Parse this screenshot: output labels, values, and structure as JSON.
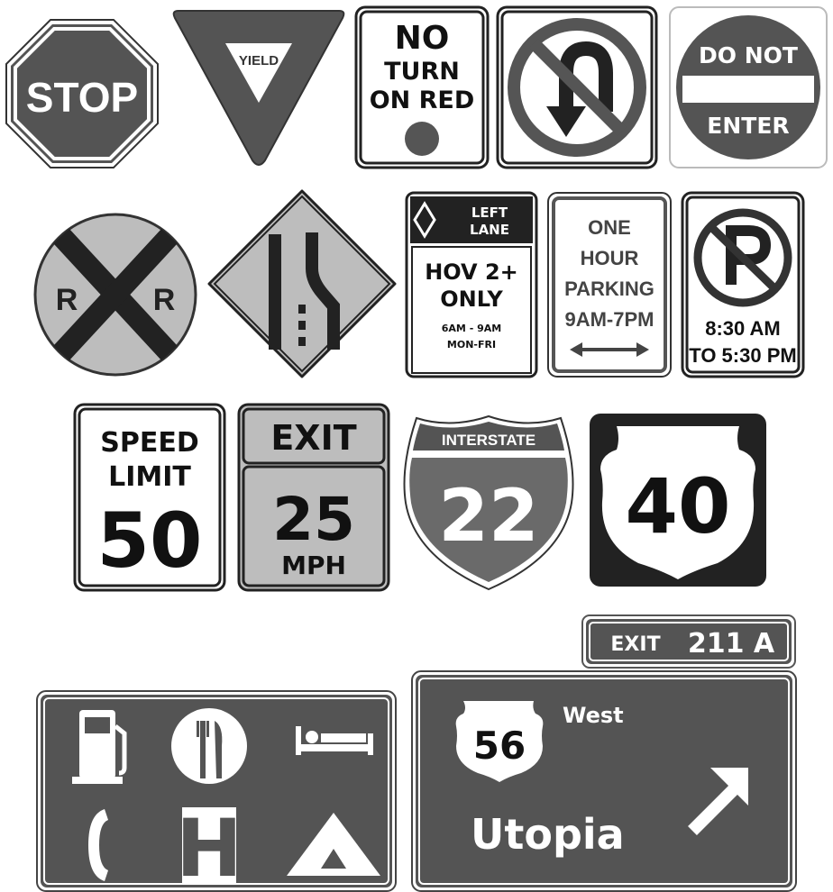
{
  "colors": {
    "dark": "#545454",
    "green_guide": "#5c5c5c",
    "yellow_warning": "#bdbdbd",
    "black": "#111111",
    "white": "#ffffff"
  },
  "stop": {
    "label": "STOP"
  },
  "yield": {
    "label": "YIELD"
  },
  "no_turn_on_red": {
    "line1": "NO",
    "line2": "TURN",
    "line3": "ON RED"
  },
  "no_u_turn": {
    "icon": "no-u-turn-icon"
  },
  "do_not_enter": {
    "line1": "DO NOT",
    "line2": "ENTER"
  },
  "railroad": {
    "left": "R",
    "right": "R"
  },
  "lane_ends": {
    "icon": "right-lane-ends-icon"
  },
  "hov": {
    "header_line1": "LEFT",
    "header_line2": "LANE",
    "line1": "HOV 2+",
    "line2": "ONLY",
    "hours": "6AM - 9AM",
    "days": "MON-FRI"
  },
  "one_hour_parking": {
    "line1": "ONE",
    "line2": "HOUR",
    "line3": "PARKING",
    "hours": "9AM-7PM"
  },
  "no_parking": {
    "line1": "8:30 AM",
    "line2": "TO 5:30 PM"
  },
  "speed_limit": {
    "line1": "SPEED",
    "line2": "LIMIT",
    "value": "50"
  },
  "exit_speed": {
    "header": "EXIT",
    "value": "25",
    "unit": "MPH"
  },
  "interstate": {
    "header": "INTERSTATE",
    "number": "22"
  },
  "us_route": {
    "number": "40"
  },
  "exit_tab": {
    "label": "EXIT",
    "number": "211 A"
  },
  "services": {
    "icons": [
      "gas-icon",
      "food-icon",
      "lodging-icon",
      "phone-icon",
      "hospital-icon",
      "camping-icon"
    ],
    "hospital_letter": "H"
  },
  "guide": {
    "route": "56",
    "direction": "West",
    "destination": "Utopia"
  }
}
